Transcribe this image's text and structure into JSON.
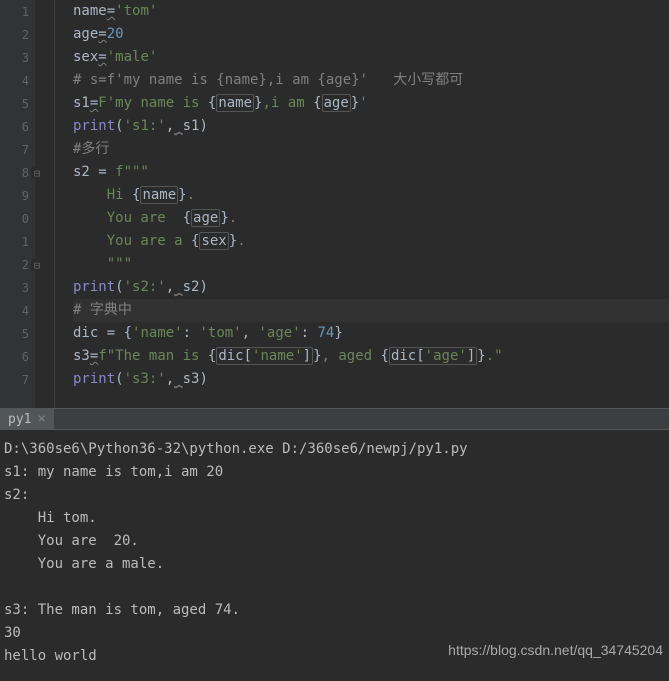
{
  "gutter_lines": [
    "1",
    "2",
    "3",
    "4",
    "5",
    "6",
    "7",
    "8",
    "9",
    "0",
    "1",
    "2",
    "3",
    "4",
    "5",
    "6",
    "7"
  ],
  "fold_icons": {
    "7": "⊟",
    "11": "⊟"
  },
  "code": {
    "l1": {
      "var": "name",
      "op": "=",
      "str": "'tom'"
    },
    "l2": {
      "var": "age",
      "op": "=",
      "num": "20"
    },
    "l3": {
      "var": "sex",
      "op": "=",
      "str": "'male'"
    },
    "l4": {
      "comment": "# s=f'my name is {name},i am {age}'   大小写都可"
    },
    "l5": {
      "var": "s1",
      "op": "=",
      "prefix": "F",
      "q": "'",
      "t1": "my name is ",
      "b1": "{",
      "ref1": "name",
      "e1": "}",
      "t2": ",i am ",
      "b2": "{",
      "ref2": "age",
      "e2": "}",
      "endq": "'"
    },
    "l6": {
      "fn": "print",
      "lp": "(",
      "str": "'s1:'",
      "comma": ",",
      "sq": "_",
      "arg": "s1",
      "rp": ")"
    },
    "l7": {
      "comment": "#多行"
    },
    "l8": {
      "var": "s2",
      "eq": " = ",
      "prefix": "f",
      "tq": "\"\"\""
    },
    "l9": {
      "indent": "    ",
      "t1": "Hi ",
      "b1": "{",
      "ref1": "name",
      "e1": "}",
      "t2": "."
    },
    "l10": {
      "indent": "    ",
      "t1": "You are  ",
      "b1": "{",
      "ref1": "age",
      "e1": "}",
      "t2": "."
    },
    "l11": {
      "indent": "    ",
      "t1": "You are a ",
      "b1": "{",
      "ref1": "sex",
      "e1": "}",
      "t2": "."
    },
    "l12": {
      "indent": "    ",
      "tq": "\"\"\""
    },
    "l13": {
      "fn": "print",
      "lp": "(",
      "str": "'s2:'",
      "comma": ",",
      "sq": "_",
      "arg": "s2",
      "rp": ")"
    },
    "l14": {
      "comment": "# 字典中"
    },
    "l15": {
      "var": "dic",
      "eq": " = ",
      "lb": "{",
      "k1": "'name'",
      "c1": ": ",
      "v1": "'tom'",
      "cm": ", ",
      "k2": "'age'",
      "c2": ": ",
      "v2": "74",
      "rb": "}"
    },
    "l16": {
      "var": "s3",
      "op": "=",
      "prefix": "f",
      "q": "\"",
      "t1": "The man is ",
      "b1": "{",
      "ref1": "dic[",
      "k1": "'name'",
      "ref1b": "]",
      "e1": "}",
      "t2": ", aged ",
      "b2": "{",
      "ref2": "dic[",
      "k2": "'age'",
      "ref2b": "]",
      "e2": "}",
      "t3": ".",
      "endq": "\""
    },
    "l17": {
      "fn": "print",
      "lp": "(",
      "str": "'s3:'",
      "comma": ",",
      "sq": "_",
      "arg": "s3",
      "rp": ")"
    }
  },
  "tab": {
    "label": "py1",
    "close": "×"
  },
  "console": {
    "lines": [
      "D:\\360se6\\Python36-32\\python.exe D:/360se6/newpj/py1.py",
      "s1: my name is tom,i am 20",
      "s2: ",
      "    Hi tom.",
      "    You are  20.",
      "    You are a male.",
      "    ",
      "s3: The man is tom, aged 74.",
      "30",
      "hello world"
    ]
  },
  "watermark": "https://blog.csdn.net/qq_34745204"
}
